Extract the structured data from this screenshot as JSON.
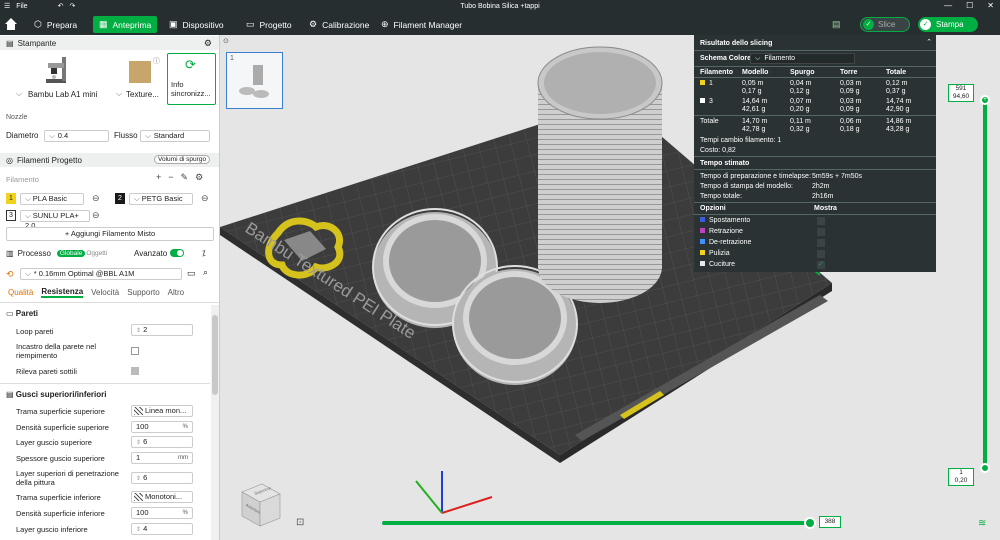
{
  "titlebar": {
    "menu_label": "File",
    "title": "Tubo Bobina Silica +tappi"
  },
  "tabs": [
    {
      "label": "Prepara",
      "icon": "cube-icon"
    },
    {
      "label": "Anteprima",
      "icon": "grid-icon"
    },
    {
      "label": "Dispositivo",
      "icon": "device-icon"
    },
    {
      "label": "Progetto",
      "icon": "folder-icon"
    },
    {
      "label": "Calibrazione",
      "icon": "calibration-icon"
    },
    {
      "label": "Filament Manager",
      "icon": "globe-icon"
    }
  ],
  "toolbar": {
    "slice_label": "Slice",
    "print_label": "Stampa"
  },
  "printer": {
    "header": "Stampante",
    "name": "Bambu Lab A1 mini",
    "plate": "Texture...",
    "sync": "Info sincronizz...",
    "nozzle_label": "Nozzle",
    "diameter_label": "Diametro",
    "diameter_value": "0.4",
    "flow_label": "Flusso",
    "flow_value": "Standard"
  },
  "filaments": {
    "header": "Filamenti Progetto",
    "purge_label": "Volumi di spurgo",
    "filament_label": "Filamento",
    "items": [
      {
        "num": "1",
        "name": "PLA Basic",
        "color": "#f2d21c"
      },
      {
        "num": "2",
        "name": "PETG Basic",
        "color": "#1a1a1a"
      },
      {
        "num": "3",
        "name": "SUNLU PLA+ 2.0",
        "color": "#ffffff"
      }
    ],
    "add_mixed": "+ Aggiungi Filamento Misto"
  },
  "process": {
    "header": "Processo",
    "global": "Globale",
    "objects": "Oggetti",
    "advanced": "Avanzato",
    "preset": "* 0.16mm Optimal @BBL A1M",
    "tabs": [
      "Qualità",
      "Resistenza",
      "Velocità",
      "Supporto",
      "Altro"
    ],
    "active_tab": "Resistenza",
    "walls_header": "Pareti",
    "params": [
      {
        "label": "Loop pareti",
        "value": "2",
        "unit": ""
      },
      {
        "label": "Incastro della parete nel riempimento",
        "value": "",
        "unit": ""
      },
      {
        "label": "Rileva pareti sottili",
        "value": "",
        "unit": ""
      }
    ],
    "shells_header": "Gusci superiori/inferiori",
    "shell_params": [
      {
        "label": "Trama superficie superiore",
        "value": "Linea mon...",
        "unit": ""
      },
      {
        "label": "Densità superficie superiore",
        "value": "100",
        "unit": "%"
      },
      {
        "label": "Layer guscio superiore",
        "value": "6",
        "unit": ""
      },
      {
        "label": "Spessore guscio superiore",
        "value": "1",
        "unit": "mm"
      },
      {
        "label": "Layer superiori di penetrazione della pittura",
        "value": "6",
        "unit": ""
      },
      {
        "label": "Trama superficie inferiore",
        "value": "Monotoni...",
        "unit": ""
      },
      {
        "label": "Densità superficie inferiore",
        "value": "100",
        "unit": "%"
      },
      {
        "label": "Layer guscio inferiore",
        "value": "4",
        "unit": ""
      }
    ]
  },
  "plate_text": "Bambu Textured PEI Plate",
  "slicing": {
    "title": "Risultato dello slicing",
    "scheme_label": "Schema Colore",
    "scheme_value": "Filamento",
    "cols": [
      "Filamento",
      "Modello",
      "Spurgo",
      "Torre",
      "Totale"
    ],
    "rows": [
      {
        "num": "1",
        "color": "#f2d21c",
        "model": [
          "0,05 m",
          "0,17 g"
        ],
        "purge": [
          "0,04 m",
          "0,12 g"
        ],
        "tower": [
          "0,03 m",
          "0,09 g"
        ],
        "total": [
          "0,12 m",
          "0,37 g"
        ]
      },
      {
        "num": "3",
        "color": "#ffffff",
        "model": [
          "14,64 m",
          "42,61 g"
        ],
        "purge": [
          "0,07 m",
          "0,20 g"
        ],
        "tower": [
          "0,03 m",
          "0,09 g"
        ],
        "total": [
          "14,74 m",
          "42,90 g"
        ]
      }
    ],
    "total": {
      "label": "Totale",
      "model": [
        "14,70 m",
        "42,78 g"
      ],
      "purge": [
        "0,11 m",
        "0,32 g"
      ],
      "tower": [
        "0,06 m",
        "0,18 g"
      ],
      "total": [
        "14,86 m",
        "43,28 g"
      ]
    },
    "changes": "Tempi cambio filamento:  1",
    "cost": "Costo:  0,82",
    "time_header": "Tempo stimato",
    "prep_label": "Tempo di preparazione e timelapse:",
    "prep_value": "5m59s + 7m50s",
    "model_time_label": "Tempo di stampa del modello:",
    "model_time_value": "2h2m",
    "total_time_label": "Tempo totale:",
    "total_time_value": "2h16m",
    "options_header": "Opzioni",
    "show_header": "Mostra",
    "options": [
      {
        "label": "Spostamento",
        "color": "#3b5bdb"
      },
      {
        "label": "Retrazione",
        "color": "#c040c0"
      },
      {
        "label": "De-retrazione",
        "color": "#4090ff"
      },
      {
        "label": "Pulizia",
        "color": "#f2d21c"
      },
      {
        "label": "Cuciture",
        "color": "#e8e8e8"
      }
    ]
  },
  "layers": {
    "top": "591",
    "top_h": "94,60",
    "bottom": "1",
    "bottom_h": "0,20",
    "moves": "388"
  },
  "cube": {
    "top": "Superiore",
    "front": "Anteriore"
  }
}
